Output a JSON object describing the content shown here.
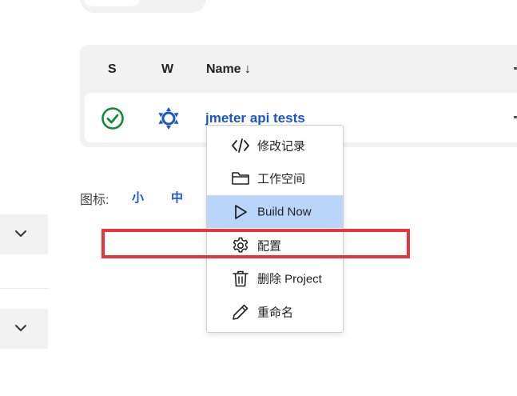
{
  "table": {
    "headers": {
      "status": "S",
      "weather": "W",
      "name": "Name ↓"
    },
    "rows": [
      {
        "name": "jmeter api tests",
        "status_icon": "success-check-icon",
        "weather_icon": "sunny-icon"
      }
    ]
  },
  "icon_size": {
    "label": "图标:",
    "options": [
      "小",
      "中"
    ]
  },
  "context_menu": {
    "items": [
      {
        "label": "修改记录",
        "icon": "code-icon"
      },
      {
        "label": "工作空间",
        "icon": "folder-icon"
      },
      {
        "label": "Build Now",
        "icon": "play-icon",
        "active": true
      },
      {
        "label": "配置",
        "icon": "gear-icon"
      },
      {
        "label": "删除 Project",
        "icon": "trash-icon"
      },
      {
        "label": "重命名",
        "icon": "pencil-icon"
      }
    ]
  },
  "colors": {
    "link": "#1a56c9",
    "success": "#138a3b",
    "menu_active": "#b9d5fa",
    "highlight": "#e8353a"
  }
}
